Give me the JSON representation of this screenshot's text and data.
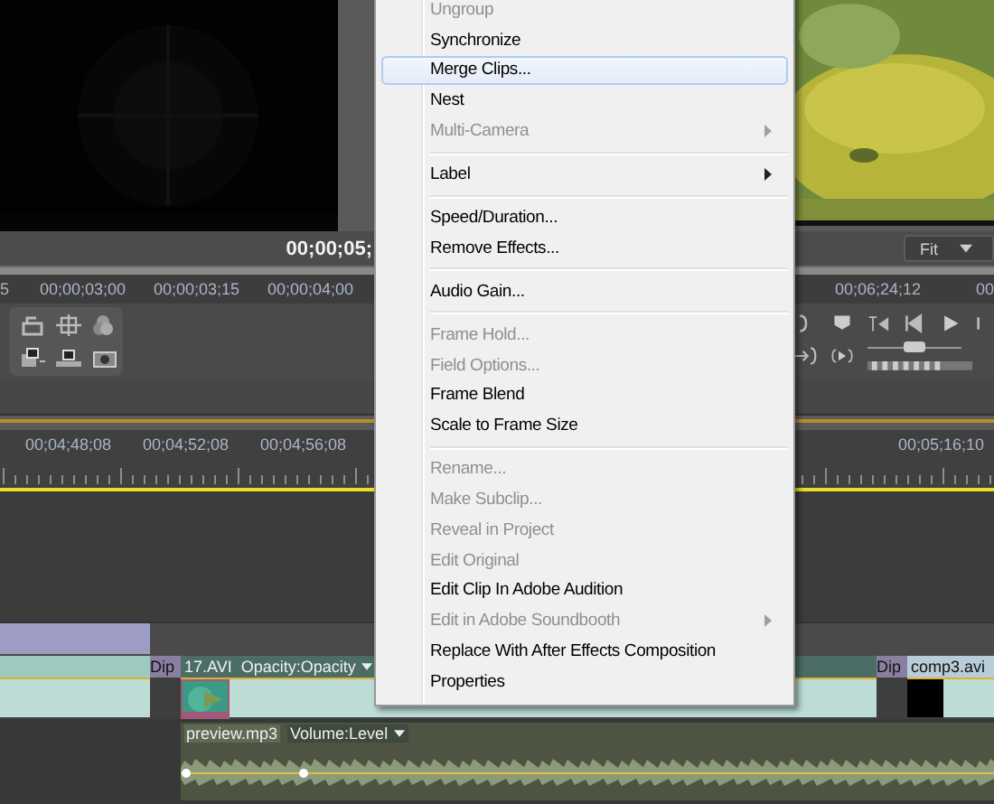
{
  "source_monitor": {
    "timecode": "00;00;05;",
    "ruler": [
      "5",
      "00;00;03;00",
      "00;00;03;15",
      "00;00;04;00"
    ]
  },
  "program_monitor": {
    "zoom": "Fit",
    "ruler": [
      "00;06;24;12",
      "00"
    ],
    "shuttle": {
      "level": 0.5
    }
  },
  "timeline": {
    "ruler_left": [
      "00;04;48;08",
      "00;04;52;08",
      "00;04;56;08"
    ],
    "ruler_right": [
      "00;05;16;10"
    ],
    "video_clips": [
      {
        "transition": "Dip",
        "name": "17.AVI",
        "effect": "Opacity:Opacity"
      },
      {
        "transition": "Dip",
        "name": "comp3.avi"
      }
    ],
    "audio_clip": {
      "name": "preview.mp3",
      "effect": "Volume:Level"
    }
  },
  "context_menu": {
    "groups": [
      {
        "items": [
          {
            "label": "Ungroup",
            "disabled": true,
            "submenu": false,
            "selected": false
          },
          {
            "label": "Synchronize",
            "disabled": false,
            "submenu": false,
            "selected": false
          },
          {
            "label": "Merge Clips...",
            "disabled": false,
            "submenu": false,
            "selected": true
          },
          {
            "label": "Nest",
            "disabled": false,
            "submenu": false,
            "selected": false
          },
          {
            "label": "Multi-Camera",
            "disabled": true,
            "submenu": true,
            "selected": false
          }
        ]
      },
      {
        "items": [
          {
            "label": "Label",
            "disabled": false,
            "submenu": true,
            "selected": false
          }
        ]
      },
      {
        "items": [
          {
            "label": "Speed/Duration...",
            "disabled": false,
            "submenu": false,
            "selected": false
          },
          {
            "label": "Remove Effects...",
            "disabled": false,
            "submenu": false,
            "selected": false
          }
        ]
      },
      {
        "items": [
          {
            "label": "Audio Gain...",
            "disabled": false,
            "submenu": false,
            "selected": false
          }
        ]
      },
      {
        "items": [
          {
            "label": "Frame Hold...",
            "disabled": true,
            "submenu": false,
            "selected": false
          },
          {
            "label": "Field Options...",
            "disabled": true,
            "submenu": false,
            "selected": false
          },
          {
            "label": "Frame Blend",
            "disabled": false,
            "submenu": false,
            "selected": false
          },
          {
            "label": "Scale to Frame Size",
            "disabled": false,
            "submenu": false,
            "selected": false
          }
        ]
      },
      {
        "items": [
          {
            "label": "Rename...",
            "disabled": true,
            "submenu": false,
            "selected": false
          },
          {
            "label": "Make Subclip...",
            "disabled": true,
            "submenu": false,
            "selected": false
          },
          {
            "label": "Reveal in Project",
            "disabled": true,
            "submenu": false,
            "selected": false
          },
          {
            "label": "Edit Original",
            "disabled": true,
            "submenu": false,
            "selected": false
          },
          {
            "label": "Edit Clip In Adobe Audition",
            "disabled": false,
            "submenu": false,
            "selected": false
          },
          {
            "label": "Edit in Adobe Soundbooth",
            "disabled": true,
            "submenu": true,
            "selected": false
          },
          {
            "label": "Replace With After Effects Composition",
            "disabled": false,
            "submenu": false,
            "selected": false
          },
          {
            "label": "Properties",
            "disabled": false,
            "submenu": false,
            "selected": false
          }
        ]
      }
    ]
  }
}
